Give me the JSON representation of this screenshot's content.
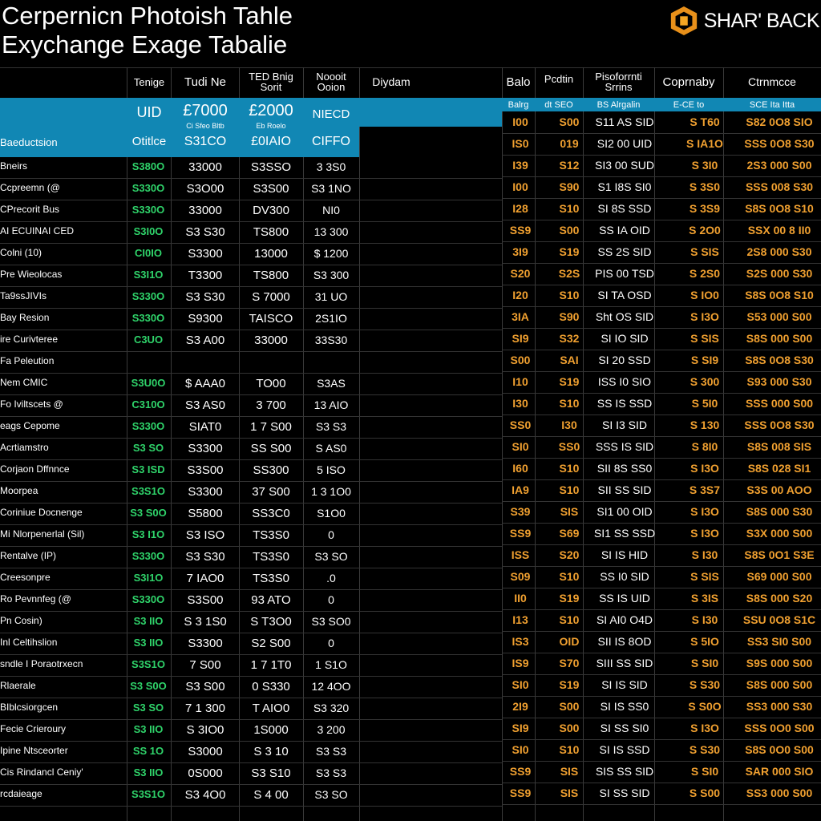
{
  "title": {
    "line1": "Cerpernicn Photoish Tahle",
    "line2": "Exychange Exage Tabalie"
  },
  "brand": {
    "label": "SHAR' BACK",
    "icon": "hexagon-logo-icon",
    "accent": "#f5a623"
  },
  "colors": {
    "band": "#1187b4",
    "green": "#2fd36a",
    "orange": "#f0a030"
  },
  "left_headers": [
    "Tenige",
    "Tudi Ne",
    "TED Bnig Sorit",
    "Noooit Ooion",
    "Diydam"
  ],
  "band": {
    "label": "Baeductsion",
    "row1": [
      "UID",
      "£7000",
      "£2000",
      "NIECD"
    ],
    "row1_sub": [
      "",
      "Ci Sfeo Bltb",
      "Eb Roelo",
      ""
    ],
    "row2": [
      "Otitlce",
      "S31CO",
      "£0IAIO",
      "CIFFO"
    ]
  },
  "right_headers": [
    "Balo",
    "Pcdtin",
    "Pisoforrnti Srrins",
    "Coprnaby",
    "Ctrnmcce"
  ],
  "right_subheaders": [
    "Balrg",
    "dt SEO",
    "BS Alrgalin",
    "E-CE to",
    "SCE Ita Itta"
  ],
  "left_rows": [
    {
      "label": "",
      "v": [
        "",
        "",
        "",
        ""
      ]
    },
    {
      "label": "",
      "v": [
        "",
        "",
        "",
        ""
      ]
    },
    {
      "label": "Bneirs",
      "v": [
        "S380O",
        "33000",
        "S3SSO",
        "3 3S0"
      ]
    },
    {
      "label": "Ccpreemn (@",
      "v": [
        "S330O",
        "S3O00",
        "S3S00",
        "S3 1NO"
      ]
    },
    {
      "label": "CPrecorit Bus",
      "v": [
        "S330O",
        "33000",
        "DV300",
        "NI0"
      ]
    },
    {
      "label": "AI ECUINAI CED",
      "v": [
        "S3I0O",
        "S3 S30",
        "TS800",
        "13 300"
      ]
    },
    {
      "label": "Colni (10)",
      "v": [
        "CI0IO",
        "S3300",
        "13000",
        "$ 1200"
      ]
    },
    {
      "label": "Pre Wieolocas",
      "v": [
        "S3I1O",
        "T3300",
        "TS800",
        "S3 300"
      ]
    },
    {
      "label": "Ta9ssJIVIs",
      "v": [
        "S330O",
        "S3 S30",
        "S 7000",
        "31 UO"
      ]
    },
    {
      "label": "Bay Resion",
      "v": [
        "S330O",
        "S9300",
        "TAISCO",
        "2S1IO"
      ]
    },
    {
      "label": "ire Curivteree",
      "v": [
        "C3UO",
        "S3 A00",
        "33000",
        "33S30"
      ]
    },
    {
      "label": "Fa Peleution",
      "v": [
        "",
        "",
        "",
        ""
      ]
    },
    {
      "label": "Nem CMIC",
      "v": [
        "S3U0O",
        "$ AAA0",
        "TO00",
        "S3AS"
      ]
    },
    {
      "label": "Fo Iviltscets @",
      "v": [
        "C310O",
        "S3 AS0",
        "3 700",
        "13 AIO"
      ]
    },
    {
      "label": "eags Cepome",
      "v": [
        "S330O",
        "SIAT0",
        "1 7 S00",
        "S3 S3"
      ]
    },
    {
      "label": "Acrtiamstro",
      "v": [
        "S3 SO",
        "S3300",
        "SS S00",
        "S AS0"
      ]
    },
    {
      "label": "Corjaon Dffnnce",
      "v": [
        "S3 ISD",
        "S3S00",
        "SS300",
        "5 ISO"
      ]
    },
    {
      "label": "Moorpea",
      "v": [
        "S3S1O",
        "S3300",
        "37 S00",
        "1 3 1O0"
      ]
    },
    {
      "label": "Coriniue Docnenge",
      "v": [
        "S3 S0O",
        "S5800",
        "SS3C0",
        "S1O0"
      ]
    },
    {
      "label": "Mi Nlorpenerlal (Sil)",
      "v": [
        "S3 I1O",
        "S3 ISO",
        "TS3S0",
        "0"
      ]
    },
    {
      "label": "Rentalve (IP)",
      "v": [
        "S330O",
        "S3 S30",
        "TS3S0",
        "S3 SO"
      ]
    },
    {
      "label": "Creesonpre",
      "v": [
        "S3I1O",
        "7 IAO0",
        "TS3S0",
        ".0"
      ]
    },
    {
      "label": "Ro Pevnnfeg (@",
      "v": [
        "S330O",
        "S3S00",
        "93 ATO",
        "0"
      ]
    },
    {
      "label": "Pn Cosin)",
      "v": [
        "S3 IIO",
        "S 3 1S0",
        "S T3O0",
        "S3 SO0"
      ]
    },
    {
      "label": "Inl Celtihslion",
      "v": [
        "S3 IIO",
        "S3300",
        "S2 S00",
        "0"
      ]
    },
    {
      "label": "sndle I Poraotrxecn",
      "v": [
        "S3S1O",
        "7 S00",
        "1 7 1T0",
        "1 S1O"
      ]
    },
    {
      "label": "Rlaerale",
      "v": [
        "S3 S0O",
        "S3 S00",
        "0 S330",
        "12 4OO"
      ]
    },
    {
      "label": "BIblcsiorgcen",
      "v": [
        "S3 SO",
        "7 1 300",
        "T AIO0",
        "S3 320"
      ]
    },
    {
      "label": "Fecie Crieroury",
      "v": [
        "S3 IIO",
        "S 3IO0",
        "1S000",
        "3 200"
      ]
    },
    {
      "label": "Ipine Ntsceorter",
      "v": [
        "SS 1O",
        "S3000",
        "S 3 10",
        "S3 S3"
      ]
    },
    {
      "label": "Cis Rindancl Ceniy'",
      "v": [
        "S3 IIO",
        "0S000",
        "S3 S10",
        "S3 S3"
      ]
    },
    {
      "label": "rcdaieage",
      "v": [
        "S3S1O",
        "S3 4O0",
        "S 4 00",
        "S3 SO"
      ]
    }
  ],
  "right_rows": [
    [
      "I00",
      "S00",
      "S11 AS SID",
      "S T60",
      "S82 0O8 SIO"
    ],
    [
      "IS0",
      "019",
      "SI2 00 UID",
      "S IA1O",
      "SSS 0O8 S30"
    ],
    [
      "I39",
      "S12",
      "SI3 00 SUD",
      "S 3I0",
      "2S3 000 S00"
    ],
    [
      "I00",
      "S90",
      "S1 I8S SI0",
      "S 3S0",
      "SSS 008 S30"
    ],
    [
      "I28",
      "S10",
      "SI 8S SSD",
      "S 3S9",
      "S8S 0O8 S10"
    ],
    [
      "SS9",
      "S00",
      "SS IA OID",
      "S 2O0",
      "SSX 00 8 II0"
    ],
    [
      "3I9",
      "S19",
      "SS 2S SID",
      "S SIS",
      "2S8 000 S30"
    ],
    [
      "S20",
      "S2S",
      "PIS 00 TSD",
      "S 2S0",
      "S2S 000 S30"
    ],
    [
      "I20",
      "S10",
      "SI TA OSD",
      "S IO0",
      "S8S 0O8 S10"
    ],
    [
      "3IA",
      "S90",
      "Sht OS SID",
      "S I3O",
      "S53 000 S00"
    ],
    [
      "SI9",
      "S32",
      "SI IO SID",
      "S SIS",
      "S8S 000 S00"
    ],
    [
      "S00",
      "SAI",
      "SI 20 SSD",
      "S SI9",
      "S8S 0O8 S30"
    ],
    [
      "I10",
      "S19",
      "ISS I0 SIO",
      "S 300",
      "S93 000 S30"
    ],
    [
      "I30",
      "S10",
      "SS IS SSD",
      "S 5I0",
      "SSS 000 S00"
    ],
    [
      "SS0",
      "I30",
      "SI I3 SID",
      "S 130",
      "SSS 0O8 S30"
    ],
    [
      "SI0",
      "SS0",
      "SSS IS SID",
      "S 8I0",
      "S8S 008 SIS"
    ],
    [
      "I60",
      "S10",
      "SII 8S SS0",
      "S I3O",
      "S8S 028 SI1"
    ],
    [
      "IA9",
      "S10",
      "SII SS SID",
      "S 3S7",
      "S3S 00 AOO"
    ],
    [
      "S39",
      "SIS",
      "SI1 00 OID",
      "S I3O",
      "S8S 000 S30"
    ],
    [
      "SS9",
      "S69",
      "SI1 SS SSD",
      "S I3O",
      "S3X 000 S00"
    ],
    [
      "ISS",
      "S20",
      "SI IS HID",
      "S I30",
      "S8S 0O1 S3E"
    ],
    [
      "S09",
      "S10",
      "SS I0 SID",
      "S SIS",
      "S69 000 S00"
    ],
    [
      "II0",
      "S19",
      "SS IS UID",
      "S 3IS",
      "S8S 000 S20"
    ],
    [
      "I13",
      "S10",
      "SI AI0 O4D",
      "S I30",
      "SSU 0O8 S1C"
    ],
    [
      "IS3",
      "OID",
      "SII IS 8OD",
      "S 5IO",
      "SS3 SI0 S00"
    ],
    [
      "IS9",
      "S70",
      "SIII SS SID",
      "S SI0",
      "S9S 000 S00"
    ],
    [
      "SI0",
      "S19",
      "SI IS SID",
      "S S30",
      "S8S 000 S00"
    ],
    [
      "2I9",
      "S00",
      "SI IS SS0",
      "S S0O",
      "SS3 000 S30"
    ],
    [
      "SI9",
      "S00",
      "SI SS SI0",
      "S I3O",
      "SSS 0O0 S00"
    ],
    [
      "SI0",
      "S10",
      "SI IS SSD",
      "S S30",
      "S8S 0O0 S00"
    ],
    [
      "SS9",
      "SIS",
      "SIS SS SID",
      "S SI0",
      "SAR 000 SIO"
    ],
    [
      "SS9",
      "SIS",
      "SI SS SID",
      "S S00",
      "SS3 000 S00"
    ]
  ]
}
